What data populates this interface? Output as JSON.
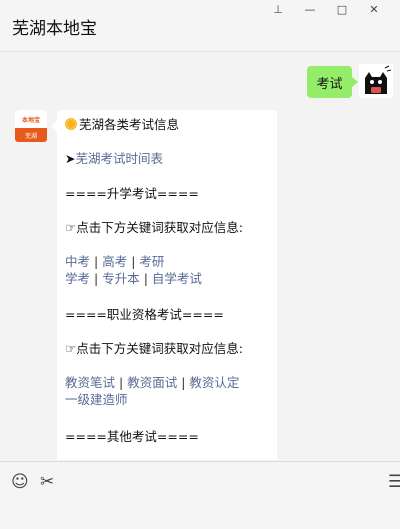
{
  "window": {
    "title": "芜湖本地宝",
    "controls": [
      "pin",
      "minimize",
      "maximize",
      "close"
    ],
    "control_glyphs": [
      "⊥",
      "—",
      "□",
      "✕"
    ]
  },
  "chat": {
    "outgoing": {
      "text": "考试"
    },
    "bot_avatar": {
      "logo_top": "本地宝",
      "logo_bottom": "芜湖"
    },
    "incoming": {
      "header": "芜湖各类考试信息",
      "arrow": "➤",
      "exam_schedule_link": "芜湖考试时间表",
      "section1_title": "====升学考试====",
      "hint1": "☞点击下方关键词获取对应信息:",
      "links_row1": [
        "中考",
        "高考",
        "考研"
      ],
      "links_row2": [
        "学考",
        "专升本",
        "自学考试"
      ],
      "section2_title": "====职业资格考试====",
      "hint2": "☞点击下方关键词获取对应信息:",
      "links_row3": [
        "教资笔试",
        "教资面试",
        "教资认定"
      ],
      "links_row4": [
        "一级建造师"
      ],
      "section3_title": "====其他考试====",
      "separator": "|"
    }
  },
  "toolbar": {
    "emoji_icon": "☺",
    "scissors_icon": "✂",
    "chat_icon": "☰"
  }
}
